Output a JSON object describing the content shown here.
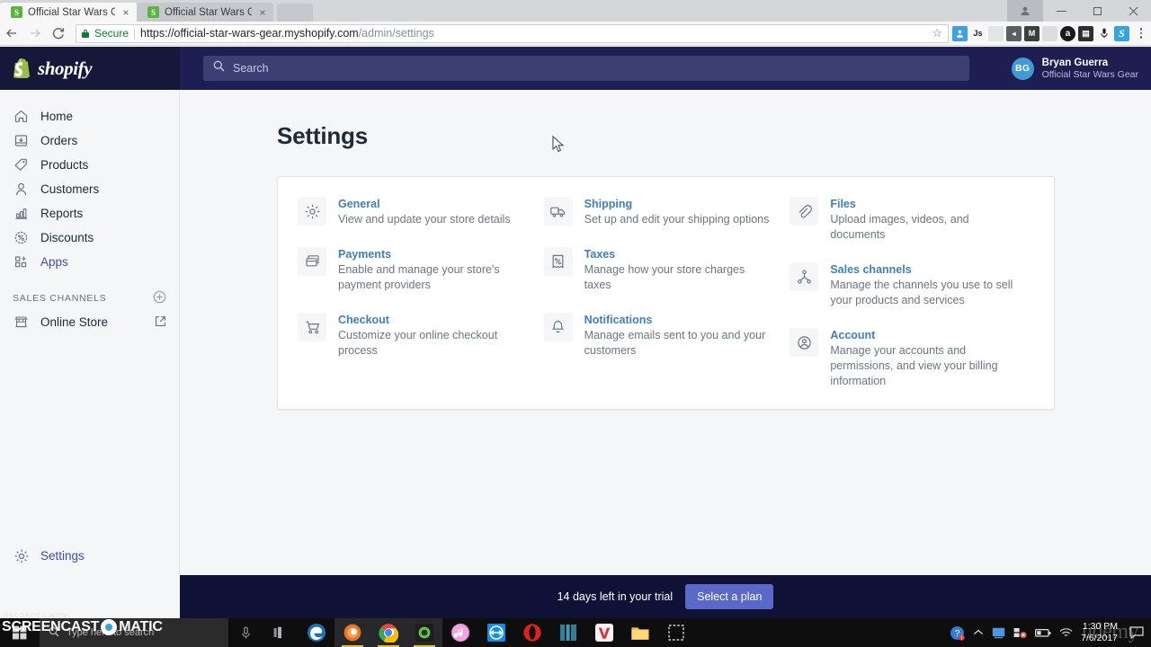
{
  "browser": {
    "tabs": [
      {
        "title": "Official Star Wars Gear –",
        "favicon": "shopify-favicon",
        "active": true,
        "close_label": "×"
      },
      {
        "title": "Official Star Wars Gear –",
        "favicon": "shopify-favicon",
        "active": false,
        "close_label": "×"
      }
    ],
    "new_tab_label": "",
    "window_controls": {
      "profile": "👤",
      "minimize": "–",
      "maximize": "❐",
      "close": "✕"
    },
    "nav": {
      "back": "←",
      "forward": "→",
      "reload": "⟳"
    },
    "omnibox": {
      "security_label": "Secure",
      "url_host": "https://official-star-wars-gear.myshopify.com",
      "url_path": "/admin/settings",
      "bookmark_star": "☆"
    },
    "extensions": [
      {
        "name": "extension-keeper",
        "glyph": "👤",
        "bg": "#3fa0e8"
      },
      {
        "name": "extension-js",
        "glyph": "Js",
        "bg": "#f7f7f7",
        "fg": "#202020"
      },
      {
        "name": "extension-grey-1",
        "glyph": "",
        "bg": "#e3e4e6"
      },
      {
        "name": "extension-pocket",
        "glyph": "◀",
        "bg": "#5c6066"
      },
      {
        "name": "extension-mailtrack",
        "glyph": "M",
        "bg": "#3c3f42"
      },
      {
        "name": "extension-grey-2",
        "glyph": "",
        "bg": "#dcdddf"
      },
      {
        "name": "extension-amazon",
        "glyph": "a",
        "bg": "#1a1a1a"
      },
      {
        "name": "extension-contacts",
        "glyph": "▤",
        "bg": "#2e2e2e"
      },
      {
        "name": "extension-microphone",
        "glyph": "⌕",
        "bg": "#f7f7f7",
        "fg": "#1a1a1a"
      },
      {
        "name": "extension-skype",
        "glyph": "S",
        "bg": "#35a6d8"
      }
    ],
    "menu_label": "⋮"
  },
  "shopify": {
    "brand_name": "shopify",
    "search": {
      "placeholder": "Search",
      "icon": "search-icon"
    },
    "user": {
      "initials": "BG",
      "name": "Bryan Guerra",
      "store": "Official Star Wars Gear"
    },
    "sidebar": {
      "items": [
        {
          "label": "Home",
          "icon": "home-icon"
        },
        {
          "label": "Orders",
          "icon": "orders-inbox-icon"
        },
        {
          "label": "Products",
          "icon": "tag-icon"
        },
        {
          "label": "Customers",
          "icon": "person-icon"
        },
        {
          "label": "Reports",
          "icon": "bar-chart-icon"
        },
        {
          "label": "Discounts",
          "icon": "percent-badge-icon"
        },
        {
          "label": "Apps",
          "icon": "apps-grid-icon"
        }
      ],
      "section_title": "SALES CHANNELS",
      "section_add_icon": "plus-circle-icon",
      "channels": [
        {
          "label": "Online Store",
          "icon": "storefront-icon",
          "external_icon": "external-link-icon"
        }
      ],
      "footer": {
        "label": "Settings",
        "icon": "gear-icon"
      }
    },
    "page": {
      "title": "Settings"
    },
    "settings_columns": [
      [
        {
          "icon": "gear-icon",
          "title": "General",
          "desc": "View and update your store details"
        },
        {
          "icon": "credit-card-icon",
          "title": "Payments",
          "desc": "Enable and manage your store's payment providers"
        },
        {
          "icon": "shopping-cart-icon",
          "title": "Checkout",
          "desc": "Customize your online checkout process"
        }
      ],
      [
        {
          "icon": "delivery-truck-icon",
          "title": "Shipping",
          "desc": "Set up and edit your shipping options"
        },
        {
          "icon": "tax-receipt-icon",
          "title": "Taxes",
          "desc": "Manage how your store charges taxes"
        },
        {
          "icon": "bell-icon",
          "title": "Notifications",
          "desc": "Manage emails sent to you and your customers"
        }
      ],
      [
        {
          "icon": "paperclip-icon",
          "title": "Files",
          "desc": "Upload images, videos, and documents"
        },
        {
          "icon": "share-nodes-icon",
          "title": "Sales channels",
          "desc": "Manage the channels you use to sell your products and services"
        },
        {
          "icon": "account-circle-icon",
          "title": "Account",
          "desc": "Manage your accounts and permissions, and view your billing information"
        }
      ]
    ],
    "trial": {
      "text": "14 days left in your trial",
      "button": "Select a plan"
    }
  },
  "overlay": {
    "recorder_small": "RECORDED WITH",
    "recorder_name_left": "SCREENCAST",
    "recorder_name_right": "MATIC",
    "site_watermark": "udemy"
  },
  "taskbar": {
    "start_icon": "windows-start-icon",
    "search_placeholder": "Type here to search",
    "search_icon": "search-icon",
    "cortana_icon": "microphone-icon",
    "apps": [
      {
        "name": "taskview-icon",
        "glyph": "❙",
        "color": "#9aa0a6",
        "open": false
      },
      {
        "name": "edge-icon",
        "glyph": "e",
        "color": "#2e8fd8",
        "open": false
      },
      {
        "name": "firefox-icon",
        "glyph": "●",
        "color": "#e8732a",
        "open": true
      },
      {
        "name": "chrome-icon",
        "glyph": "◉",
        "color": "#4285f4",
        "open": true
      },
      {
        "name": "camtasia-icon",
        "glyph": "◉",
        "color": "#7ad14b",
        "open": true
      },
      {
        "name": "itunes-icon",
        "glyph": "♪",
        "color": "#e87ad1",
        "open": false
      },
      {
        "name": "teamviewer-icon",
        "glyph": "⇄",
        "color": "#0e8ee9",
        "open": false
      },
      {
        "name": "opera-icon",
        "glyph": "O",
        "color": "#e2231a",
        "open": false
      },
      {
        "name": "app-blue-bars-icon",
        "glyph": "‖",
        "color": "#2f7f9e",
        "open": false
      },
      {
        "name": "vivaldi-icon",
        "glyph": "V",
        "color": "#e02d2d",
        "open": false
      },
      {
        "name": "file-explorer-icon",
        "glyph": "▭",
        "color": "#f0c24b",
        "open": false
      },
      {
        "name": "snip-tool-icon",
        "glyph": "⬚",
        "color": "#c8c8c8",
        "open": false
      }
    ],
    "tray": [
      {
        "name": "help-alert-icon",
        "glyph": "?"
      },
      {
        "name": "chevron-up-icon",
        "glyph": "⌃"
      },
      {
        "name": "display-icon",
        "glyph": "▣"
      },
      {
        "name": "network-warning-icon",
        "glyph": "❖"
      },
      {
        "name": "battery-icon",
        "glyph": "▭"
      },
      {
        "name": "wifi-icon",
        "glyph": "◡"
      }
    ],
    "clock": {
      "time": "1:30 PM",
      "date": "7/6/2017"
    },
    "action_center_icon": "speech-bubble-icon"
  }
}
